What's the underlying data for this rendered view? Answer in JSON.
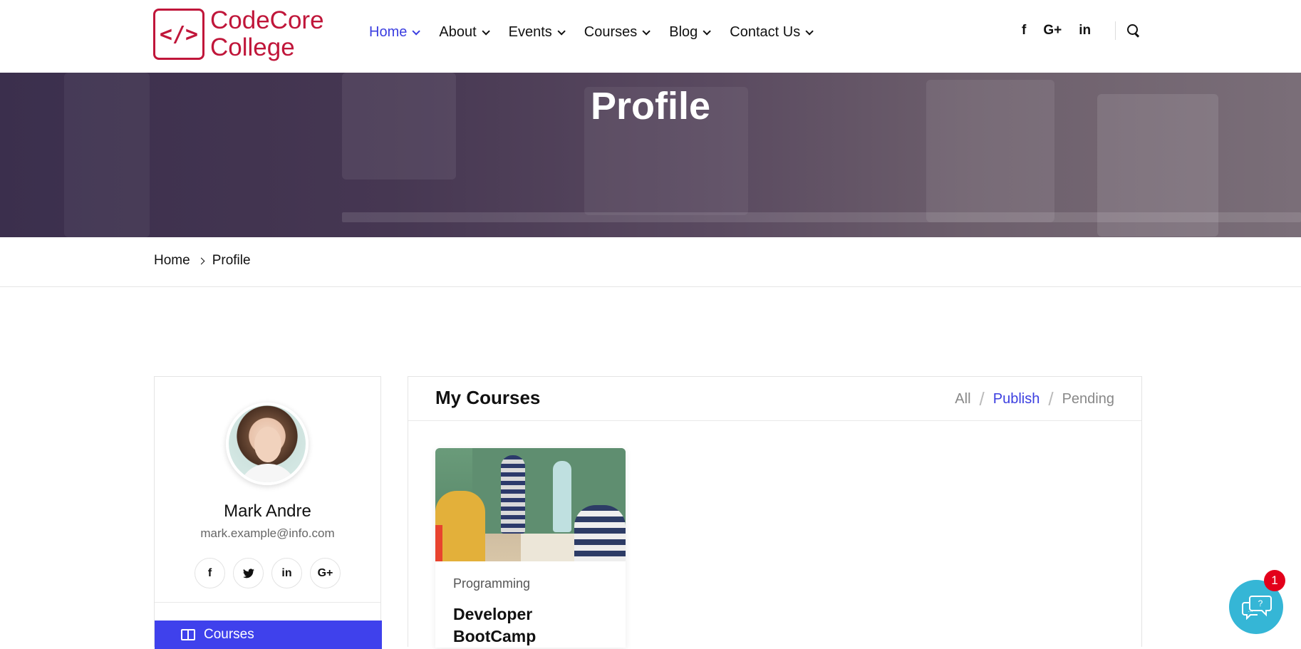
{
  "brand": {
    "line1": "CodeCore",
    "line2": "College",
    "mark": "</>"
  },
  "nav": {
    "items": [
      {
        "label": "Home",
        "active": true
      },
      {
        "label": "About"
      },
      {
        "label": "Events"
      },
      {
        "label": "Courses"
      },
      {
        "label": "Blog"
      },
      {
        "label": "Contact Us"
      }
    ]
  },
  "header_social": {
    "facebook": "f",
    "google": "G+",
    "linkedin": "in",
    "icon_search": "search-icon"
  },
  "banner": {
    "title": "Profile"
  },
  "breadcrumb": {
    "home": "Home",
    "current": "Profile"
  },
  "profile": {
    "name": "Mark Andre",
    "email": "mark.example@info.com",
    "social": {
      "facebook": "f",
      "twitter": "t",
      "linkedin": "in",
      "google": "G+"
    },
    "menu_active": "Courses"
  },
  "courses": {
    "title": "My Courses",
    "filters": {
      "all": "All",
      "publish": "Publish",
      "pending": "Pending",
      "active": "Publish"
    },
    "items": [
      {
        "category": "Programming",
        "title": "Developer BootCamp"
      }
    ]
  },
  "chat": {
    "badge": "1"
  },
  "colors": {
    "accent": "#3b3ee0",
    "brand": "#c0163a",
    "menu_active_bg": "#3f41ec",
    "chat": "#35b6d6",
    "badge": "#e3001b"
  }
}
